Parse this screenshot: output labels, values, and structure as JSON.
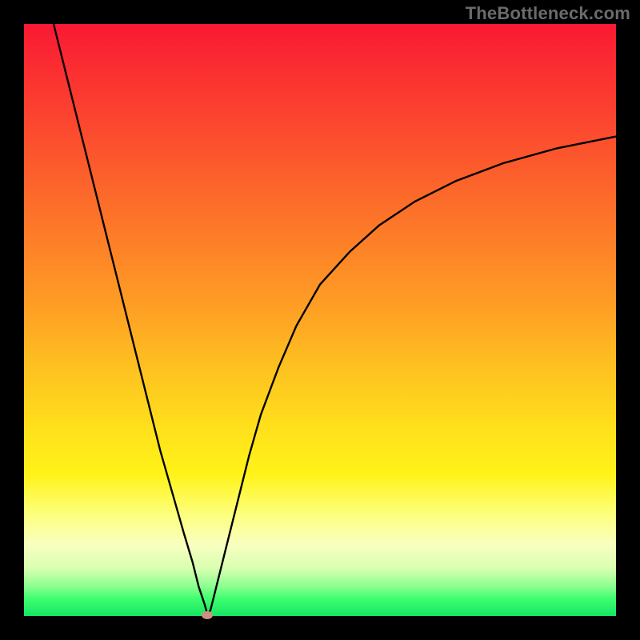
{
  "watermark": "TheBottleneck.com",
  "chart_data": {
    "type": "line",
    "title": "",
    "xlabel": "",
    "ylabel": "",
    "xlim": [
      0,
      100
    ],
    "ylim": [
      0,
      100
    ],
    "grid": false,
    "legend": false,
    "series": [
      {
        "name": "bottleneck-curve",
        "x": [
          5,
          7,
          9,
          11,
          13,
          15,
          17,
          19,
          21,
          23,
          25,
          27,
          28.5,
          29.5,
          30.5,
          31.0,
          31.5,
          32.5,
          34,
          36,
          38,
          40,
          43,
          46,
          50,
          55,
          60,
          66,
          73,
          81,
          90,
          100
        ],
        "values": [
          100,
          92,
          84,
          76,
          68,
          60,
          52,
          44,
          36,
          28,
          21,
          14,
          9,
          5,
          2,
          0.2,
          1,
          5,
          11,
          19,
          27,
          34,
          42,
          49,
          56,
          61.5,
          66,
          70,
          73.5,
          76.5,
          79,
          81
        ]
      }
    ],
    "marker": {
      "x": 31.0,
      "y": 0.2,
      "color": "#cf8f7f"
    },
    "background_gradient": {
      "stops": [
        {
          "pos": 0.0,
          "color": "#fa1933"
        },
        {
          "pos": 0.5,
          "color": "#fec120"
        },
        {
          "pos": 0.8,
          "color": "#fff318"
        },
        {
          "pos": 1.0,
          "color": "#16e463"
        }
      ]
    }
  }
}
